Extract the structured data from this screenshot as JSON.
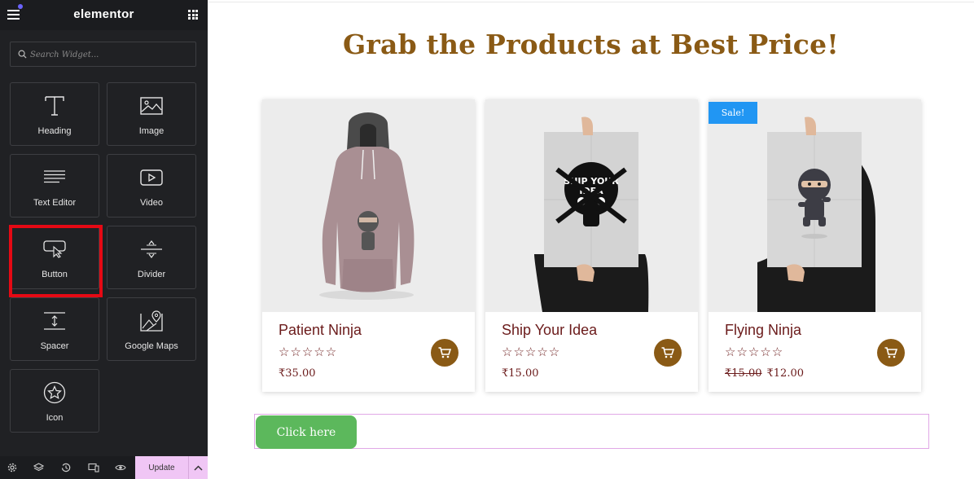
{
  "sidebar": {
    "brand": "elementor",
    "search_placeholder": "Search Widget...",
    "widgets": [
      {
        "label": "Heading",
        "icon": "heading-icon"
      },
      {
        "label": "Image",
        "icon": "image-icon"
      },
      {
        "label": "Text Editor",
        "icon": "text-editor-icon"
      },
      {
        "label": "Video",
        "icon": "video-icon"
      },
      {
        "label": "Button",
        "icon": "button-icon"
      },
      {
        "label": "Divider",
        "icon": "divider-icon"
      },
      {
        "label": "Spacer",
        "icon": "spacer-icon"
      },
      {
        "label": "Google Maps",
        "icon": "map-icon"
      },
      {
        "label": "Icon",
        "icon": "star-icon"
      }
    ],
    "highlight_color": "#e50914",
    "update_label": "Update"
  },
  "canvas": {
    "title": "Grab the Products at Best Price!",
    "products": [
      {
        "name": "Patient Ninja",
        "stars": "☆☆☆☆☆",
        "price": "₹35.00",
        "old_price": "",
        "sale": "",
        "image": "hoodie-image"
      },
      {
        "name": "Ship Your Idea",
        "stars": "☆☆☆☆☆",
        "price": "₹15.00",
        "old_price": "",
        "sale": "",
        "image": "poster-image"
      },
      {
        "name": "Flying Ninja",
        "stars": "☆☆☆☆☆",
        "price": "₹12.00",
        "old_price": "₹15.00",
        "sale": "Sale!",
        "image": "poster-image"
      }
    ],
    "button_label": "Click here",
    "accent": "#8a5a15",
    "button_color": "#5cb85c",
    "sale_color": "#2196f3"
  }
}
